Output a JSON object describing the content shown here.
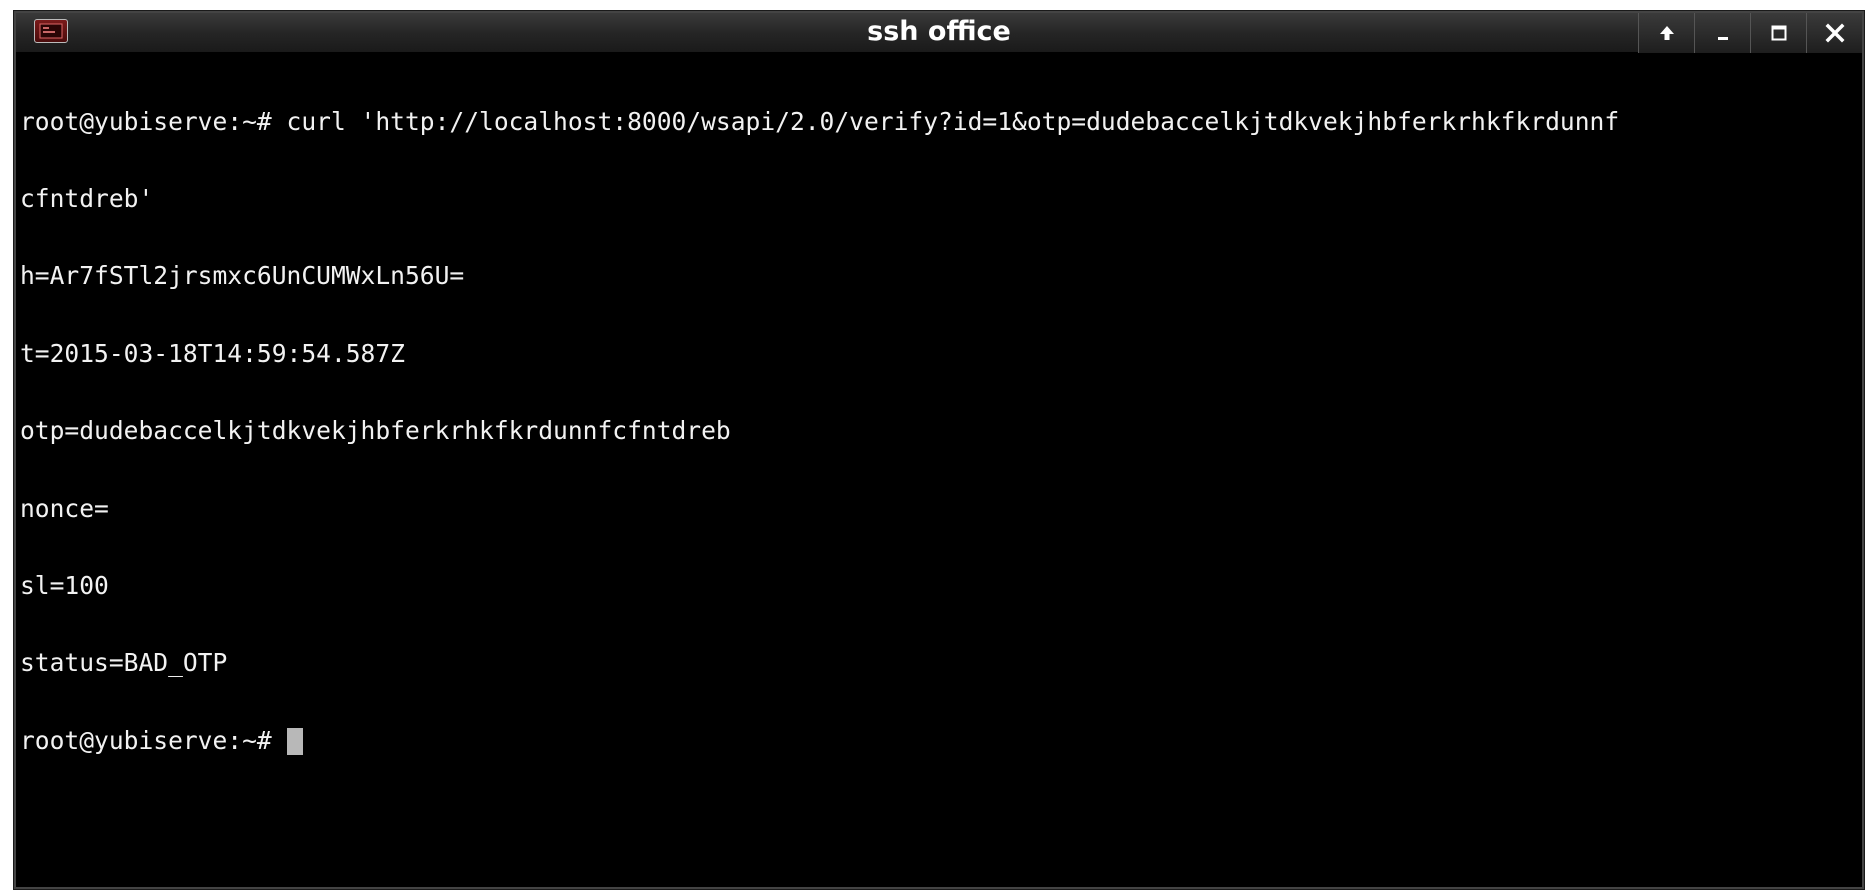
{
  "window": {
    "title": "ssh office",
    "app_icon": "terminal-app-icon",
    "controls": [
      {
        "name": "shade-up-button",
        "icon": "arrow-up-icon"
      },
      {
        "name": "minimize-button",
        "icon": "minimize-icon"
      },
      {
        "name": "maximize-button",
        "icon": "maximize-icon"
      },
      {
        "name": "close-button",
        "icon": "close-icon"
      }
    ]
  },
  "terminal": {
    "lines": [
      "root@yubiserve:~# curl 'http://localhost:8000/wsapi/2.0/verify?id=1&otp=dudebaccelkjtdkvekjhbferkrhkfkrdunnf",
      "cfntdreb'",
      "h=Ar7fSTl2jrsmxc6UnCUMWxLn56U=",
      "t=2015-03-18T14:59:54.587Z",
      "otp=dudebaccelkjtdkvekjhbferkrhkfkrdunnfcfntdreb",
      "nonce=",
      "sl=100",
      "status=BAD_OTP"
    ],
    "prompt": "root@yubiserve:~# "
  },
  "colors": {
    "background": "#000000",
    "foreground": "#f2f2f2",
    "cursor": "#b8b8b8",
    "titlebar": "#262626"
  }
}
